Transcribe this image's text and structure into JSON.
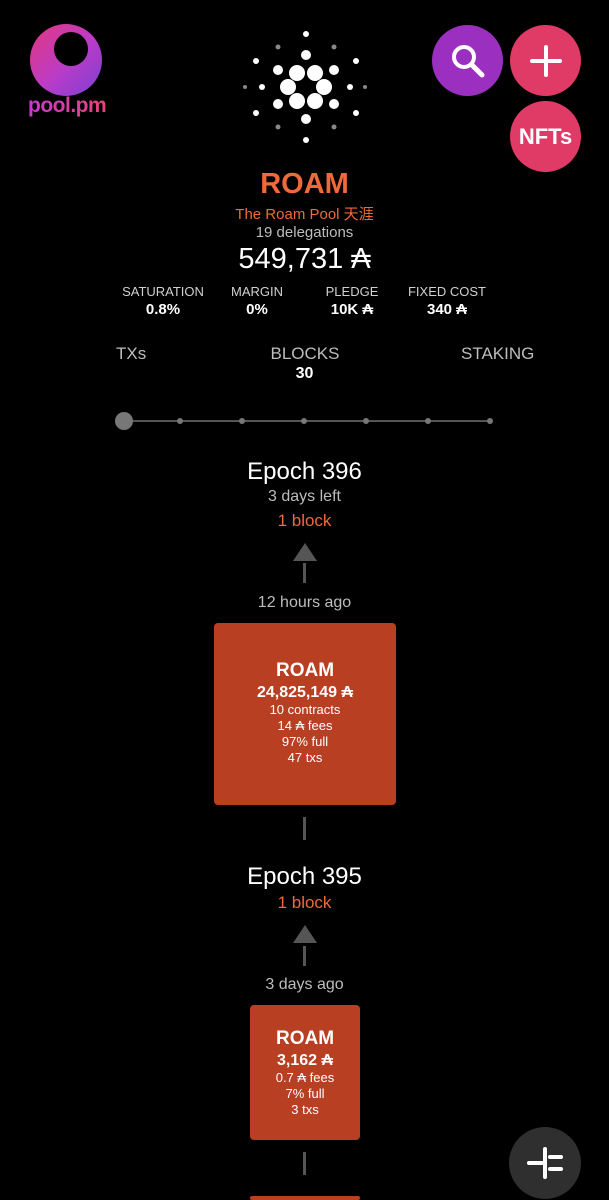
{
  "header": {
    "logo_text": "pool.pm",
    "nfts_label": "NFTs"
  },
  "pool": {
    "ticker": "ROAM",
    "name": "The Roam Pool 天涯",
    "delegations": "19 delegations",
    "live_stake": "549,731 ₳",
    "stats": [
      {
        "label": "SATURATION",
        "value": "0.8%"
      },
      {
        "label": "MARGIN",
        "value": "0%"
      },
      {
        "label": "PLEDGE",
        "value": "10K ₳"
      },
      {
        "label": "FIXED COST",
        "value": "340 ₳"
      }
    ]
  },
  "tabs": {
    "txs": "TXs",
    "blocks": "BLOCKS",
    "blocks_count": "30",
    "staking": "STAKING"
  },
  "timeline": {
    "epoch_a": {
      "title": "Epoch 396",
      "time_left": "3 days left",
      "blocks": "1 block"
    },
    "block_a": {
      "time_ago": "12 hours ago",
      "ticker": "ROAM",
      "size": "24,825,149 ₳",
      "contracts": "10 contracts",
      "fees": "14 ₳ fees",
      "full": "97% full",
      "txs": "47 txs"
    },
    "epoch_b": {
      "title": "Epoch 395",
      "blocks": "1 block"
    },
    "block_b": {
      "time_ago": "3 days ago",
      "ticker": "ROAM",
      "size": "3,162 ₳",
      "fees": "0.7 ₳ fees",
      "full": "7% full",
      "txs": "3 txs"
    }
  },
  "colors": {
    "accent": "#ef6a3a",
    "block_card": "#b93f22",
    "search_button": "#9b30c0",
    "add_button": "#e03a66"
  },
  "icons": {
    "search": "search-icon",
    "add": "plus-icon",
    "cardano": "cardano-logo-icon",
    "fab": "split-view-icon"
  }
}
